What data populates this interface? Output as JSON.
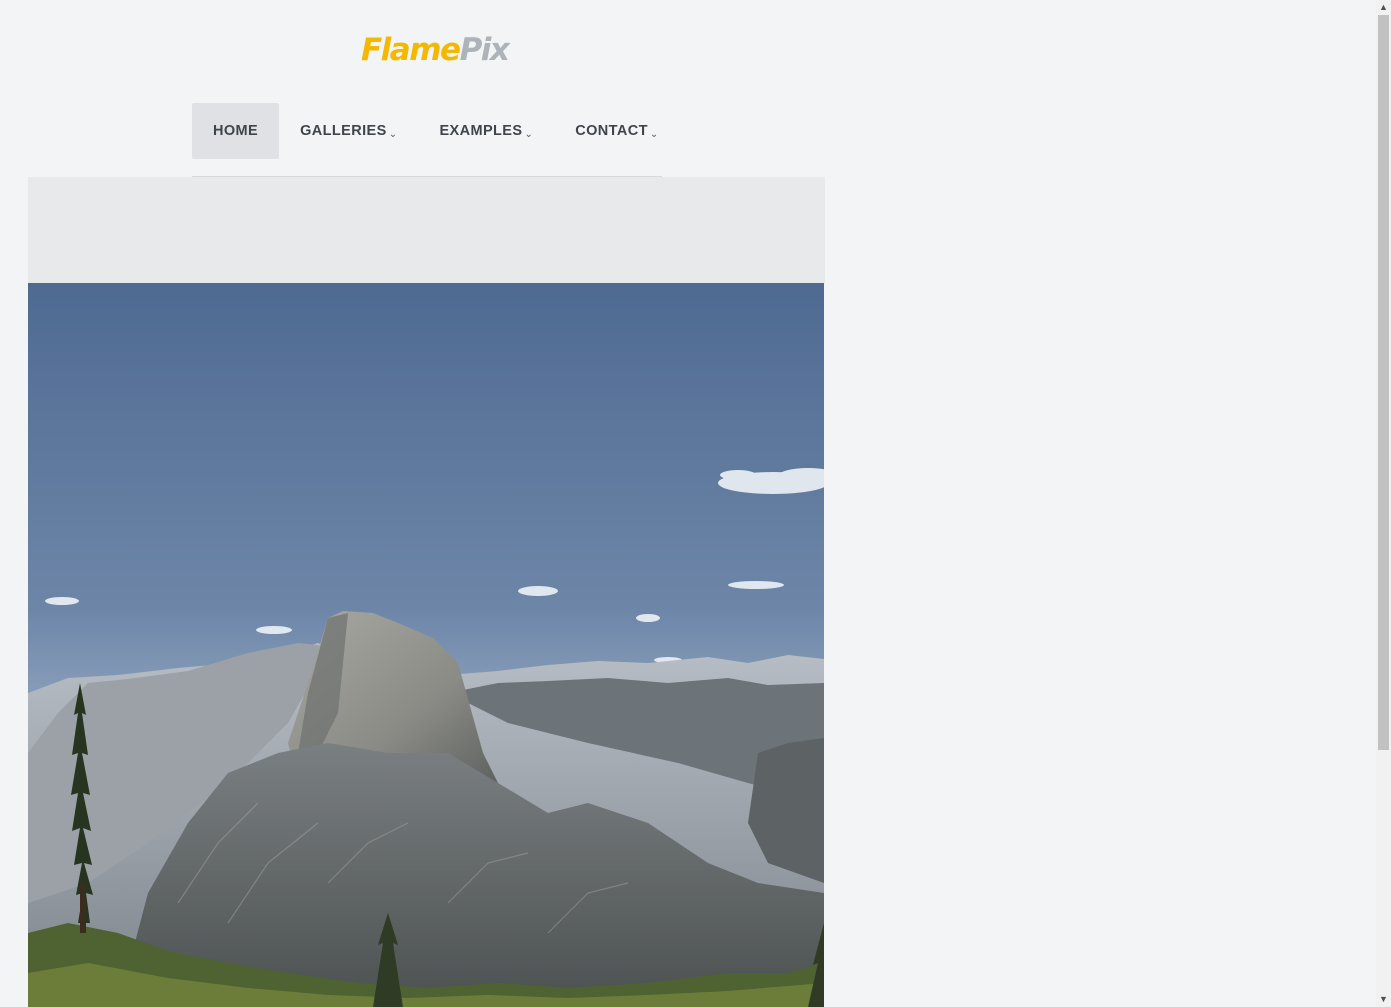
{
  "logo": {
    "part1": "Flame",
    "part2": "Pix"
  },
  "nav": {
    "items": [
      {
        "label": "HOME",
        "active": true,
        "dropdown": false
      },
      {
        "label": "GALLERIES",
        "active": false,
        "dropdown": true
      },
      {
        "label": "EXAMPLES",
        "active": false,
        "dropdown": true
      },
      {
        "label": "CONTACT",
        "active": false,
        "dropdown": true
      }
    ],
    "dropdown_glyph": "⌄"
  },
  "hero": {
    "image": "mountain-landscape-photo"
  },
  "scrollbar": {
    "up_glyph": "▲",
    "down_glyph": "▼"
  },
  "colors": {
    "logo_primary": "#f5b800",
    "logo_secondary": "#aeb3b9",
    "nav_active_bg": "#dfe1e4",
    "page_bg": "#f3f4f6",
    "banner_bg": "#e8e9eb"
  }
}
